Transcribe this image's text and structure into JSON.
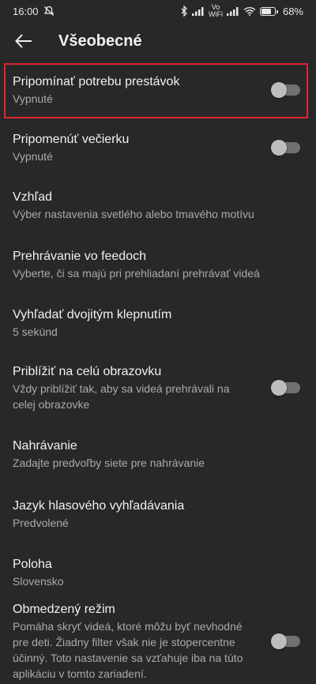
{
  "status_bar": {
    "time": "16:00",
    "network_label_top": "Vo",
    "network_label_bottom": "WiFi",
    "battery": "68%"
  },
  "header": {
    "title": "Všeobecné",
    "back_icon": "arrow-left-icon"
  },
  "settings": [
    {
      "title": "Pripomínať potrebu prestávok",
      "subtitle": "Vypnuté",
      "toggle": false,
      "highlighted": true
    },
    {
      "title": "Pripomenúť večierku",
      "subtitle": "Vypnuté",
      "toggle": false
    },
    {
      "title": "Vzhľad",
      "subtitle": "Výber nastavenia svetlého alebo tmavého motívu"
    },
    {
      "title": "Prehrávanie vo feedoch",
      "subtitle": "Vyberte, či sa majú pri prehliadaní prehrávať videá"
    },
    {
      "title": "Vyhľadať dvojitým klepnutím",
      "subtitle": "5 sekúnd"
    },
    {
      "title": "Priblížiť na celú obrazovku",
      "subtitle": "Vždy priblížiť tak, aby sa videá prehrávali na celej obrazovke",
      "toggle": false
    },
    {
      "title": "Nahrávanie",
      "subtitle": "Zadajte predvoľby siete pre nahrávanie"
    },
    {
      "title": "Jazyk hlasového vyhľadávania",
      "subtitle": "Predvolené"
    },
    {
      "title": "Poloha",
      "subtitle": "Slovensko"
    },
    {
      "title": "Obmedzený režim",
      "subtitle": "Pomáha skryť videá, ktoré môžu byť nevhodné pre deti. Žiadny filter však nie je stopercentne účinný. Toto nastavenie sa vzťahuje iba na túto aplikáciu v tomto zariadení.",
      "toggle": false
    }
  ],
  "colors": {
    "background": "#282828",
    "text_primary": "#f1f1f1",
    "text_secondary": "#aaaaaa",
    "highlight_border": "#e0262f"
  }
}
